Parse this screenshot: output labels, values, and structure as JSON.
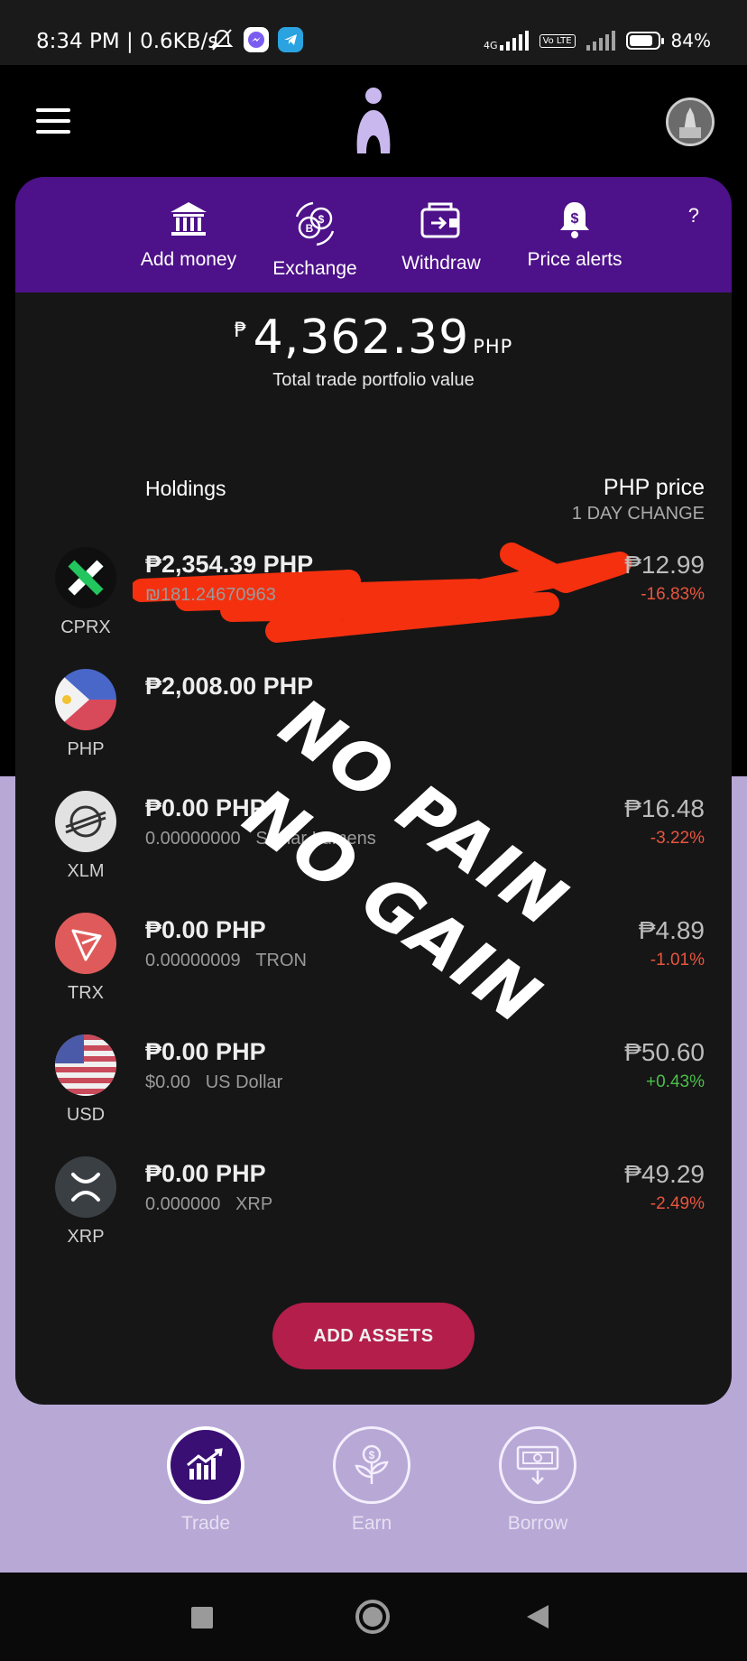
{
  "status_bar": {
    "time": "8:34 PM",
    "net_speed": "0.6KB/s",
    "network": "4G",
    "lte": "Vo LTE",
    "battery": "84%",
    "battery_level": 0.84
  },
  "header": {
    "menu_icon": "hamburger-icon",
    "logo_icon": "app-logo",
    "avatar_icon": "profile-avatar"
  },
  "actions": {
    "add_money": "Add money",
    "exchange": "Exchange",
    "withdraw": "Withdraw",
    "price_alerts": "Price alerts",
    "help": "?"
  },
  "portfolio": {
    "peso_sign": "₱",
    "value": "4,362.39",
    "currency": "PHP",
    "label": "Total trade portfolio value"
  },
  "table_header": {
    "holdings": "Holdings",
    "price": "PHP price",
    "change": "1 DAY CHANGE"
  },
  "assets": [
    {
      "symbol": "CPRX",
      "amount": "₱2,354.39 PHP",
      "quantity": "₪181.24670963",
      "name": "",
      "price": "₱12.99",
      "change": "-16.83%",
      "trend": "neg"
    },
    {
      "symbol": "PHP",
      "amount": "₱2,008.00 PHP",
      "quantity": "",
      "name": "",
      "price": "",
      "change": "",
      "trend": ""
    },
    {
      "symbol": "XLM",
      "amount": "₱0.00 PHP",
      "quantity": "0.00000000",
      "name": "Stellar Lumens",
      "price": "₱16.48",
      "change": "-3.22%",
      "trend": "neg"
    },
    {
      "symbol": "TRX",
      "amount": "₱0.00 PHP",
      "quantity": "0.00000009",
      "name": "TRON",
      "price": "₱4.89",
      "change": "-1.01%",
      "trend": "neg"
    },
    {
      "symbol": "USD",
      "amount": "₱0.00 PHP",
      "quantity": "$0.00",
      "name": "US Dollar",
      "price": "₱50.60",
      "change": "+0.43%",
      "trend": "pos"
    },
    {
      "symbol": "XRP",
      "amount": "₱0.00 PHP",
      "quantity": "0.000000",
      "name": "XRP",
      "price": "₱49.29",
      "change": "-2.49%",
      "trend": "neg"
    }
  ],
  "add_assets": "ADD ASSETS",
  "overlay_text": {
    "line1": "NO PAIN",
    "line2": "NO GAIN"
  },
  "bottom_nav": {
    "trade": "Trade",
    "earn": "Earn",
    "borrow": "Borrow"
  },
  "colors": {
    "purple": "#4d1189",
    "card": "#161616",
    "lavender": "#b8a8d6",
    "accent": "#b31e4a",
    "negative": "#e8553f",
    "positive": "#4cbf4a"
  }
}
